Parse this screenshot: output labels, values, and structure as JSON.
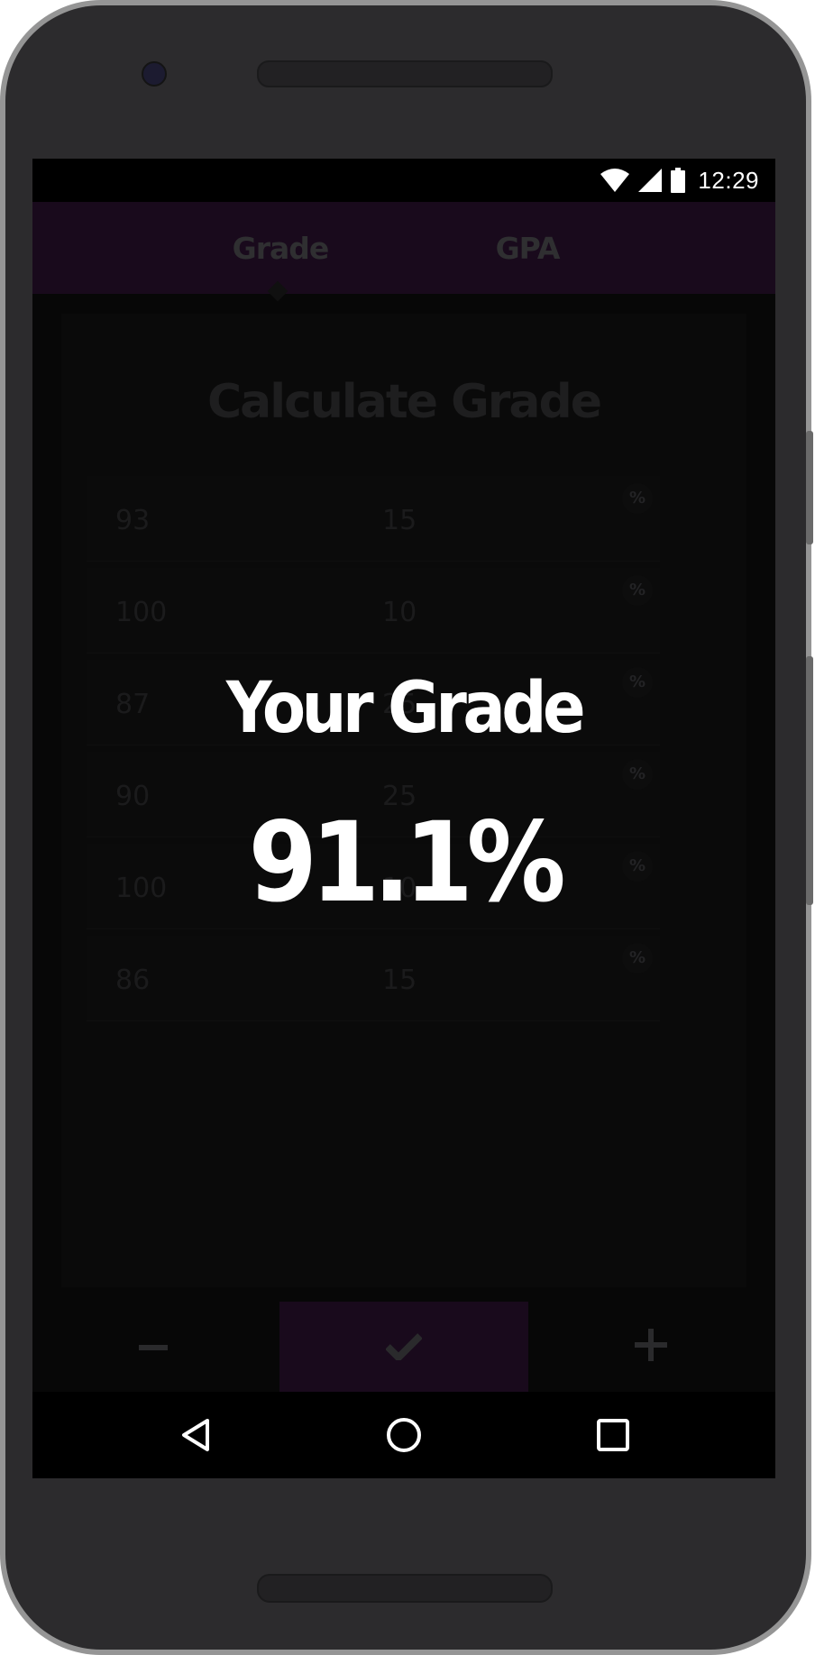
{
  "status_bar": {
    "time": "12:29",
    "icons": [
      "wifi-icon",
      "cell-signal-icon",
      "battery-icon"
    ]
  },
  "tabs": [
    {
      "label": "Grade",
      "selected": true
    },
    {
      "label": "GPA",
      "selected": false
    }
  ],
  "form": {
    "title": "Calculate Grade",
    "unit": "%",
    "rows": [
      {
        "score": "93",
        "weight": "15"
      },
      {
        "score": "100",
        "weight": "10"
      },
      {
        "score": "87",
        "weight": "25"
      },
      {
        "score": "90",
        "weight": "25"
      },
      {
        "score": "100",
        "weight": "10"
      },
      {
        "score": "86",
        "weight": "15"
      }
    ]
  },
  "bottom_bar": {
    "icons": [
      "minus-icon",
      "check-icon",
      "plus-icon"
    ]
  },
  "nav_bar": {
    "icons": [
      "back-icon",
      "home-icon",
      "recents-icon"
    ]
  },
  "result": {
    "title": "Your Grade",
    "value": "91.1%"
  },
  "colors": {
    "accent": "#190a1c",
    "background": "#070707",
    "result_text": "#ffffff"
  }
}
